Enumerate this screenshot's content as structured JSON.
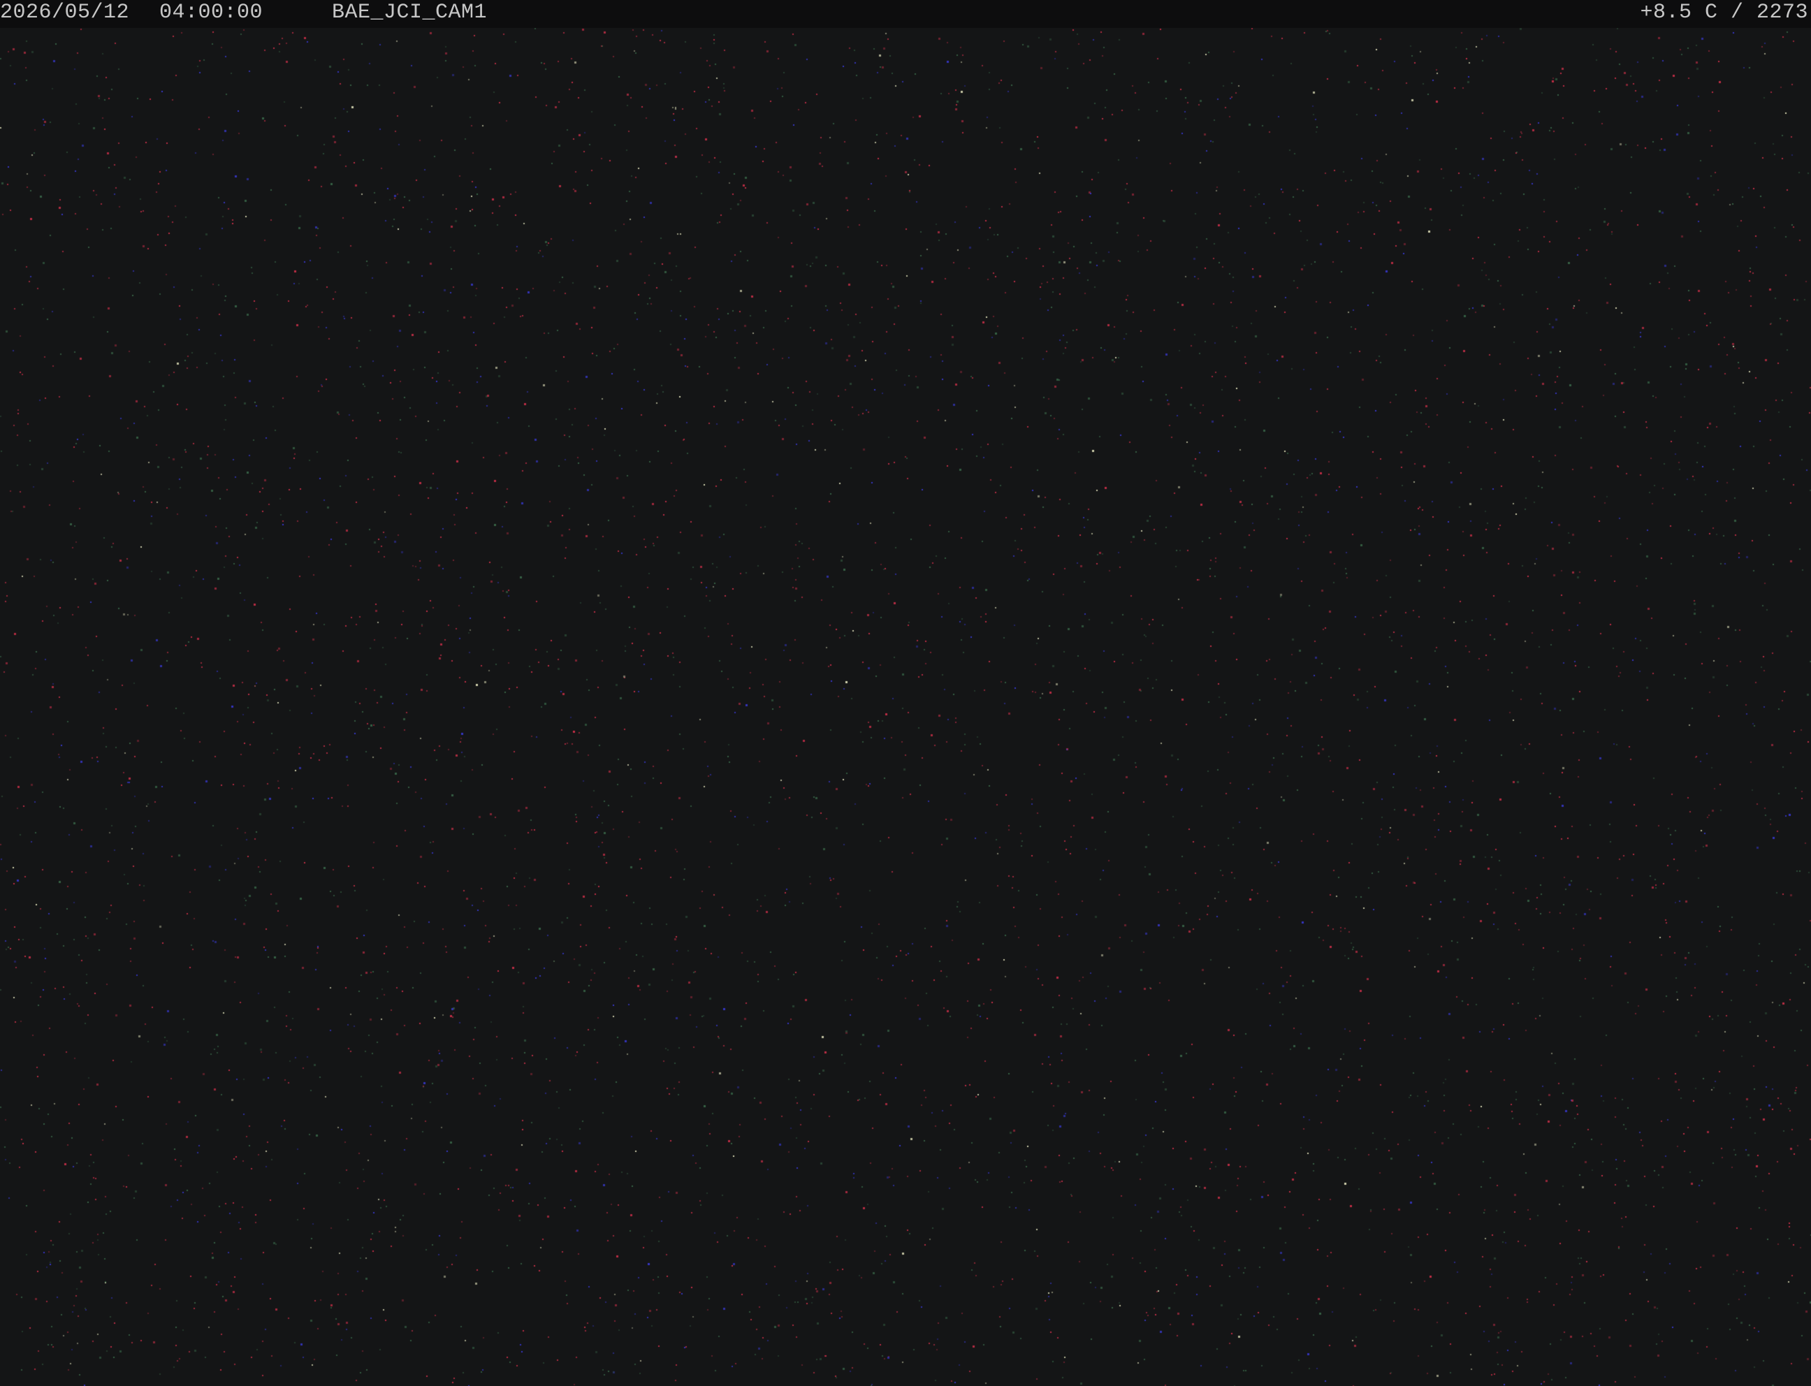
{
  "overlay": {
    "date": "2026/05/12",
    "time": "04:00:00",
    "camera_id": "BAE_JCI_CAM1",
    "reading": "+8.5 C / 2273"
  },
  "colors": {
    "background": "#141516",
    "overlay_bar": "#0d0d0e",
    "overlay_text": "#c7c7c7",
    "noise_red": "#d0304a",
    "noise_blue": "#3a3ad8",
    "noise_green": "#3a6a4a",
    "noise_white": "#e8e8c0"
  }
}
